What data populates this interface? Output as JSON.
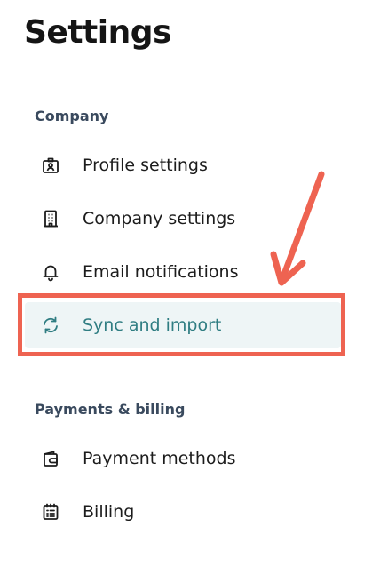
{
  "header": {
    "title": "Settings"
  },
  "sections": [
    {
      "heading": "Company",
      "items": [
        {
          "label": "Profile settings",
          "icon": "profile-badge-icon"
        },
        {
          "label": "Company settings",
          "icon": "building-icon"
        },
        {
          "label": "Email notifications",
          "icon": "bell-icon"
        },
        {
          "label": "Sync and import",
          "icon": "sync-icon",
          "active": true
        }
      ]
    },
    {
      "heading": "Payments & billing",
      "items": [
        {
          "label": "Payment methods",
          "icon": "wallet-icon"
        },
        {
          "label": "Billing",
          "icon": "receipt-icon"
        }
      ]
    }
  ],
  "colors": {
    "active_text": "#2f7d82",
    "active_background": "#eef5f6",
    "annotation": "#ee6351",
    "section_heading": "#3a4a5e"
  }
}
